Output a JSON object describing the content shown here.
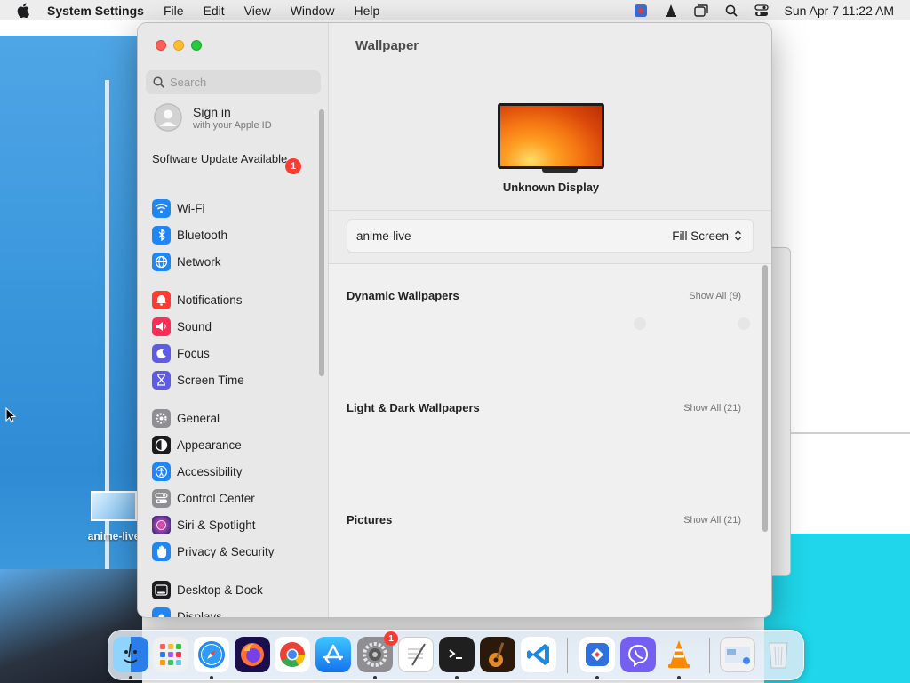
{
  "menubar": {
    "app_name": "System Settings",
    "items": [
      "File",
      "Edit",
      "View",
      "Window",
      "Help"
    ],
    "clock": "Sun Apr 7  11:22 AM"
  },
  "desktop": {
    "file_label": "anime-live"
  },
  "window": {
    "search_placeholder": "Search",
    "signin": {
      "title": "Sign in",
      "subtitle": "with your Apple ID"
    },
    "software_update": {
      "label": "Software Update Available",
      "badge": "1"
    },
    "sidebar_items": [
      {
        "label": "Wi-Fi",
        "icon": "wifi-icon",
        "color": "#1f87f5"
      },
      {
        "label": "Bluetooth",
        "icon": "bluetooth-icon",
        "color": "#1f87f5"
      },
      {
        "label": "Network",
        "icon": "globe-icon",
        "color": "#1f87f5"
      },
      {
        "label": "Notifications",
        "icon": "bell-icon",
        "color": "#ff3b30"
      },
      {
        "label": "Sound",
        "icon": "speaker-icon",
        "color": "#ff2d55"
      },
      {
        "label": "Focus",
        "icon": "moon-icon",
        "color": "#5e5ce6"
      },
      {
        "label": "Screen Time",
        "icon": "hourglass-icon",
        "color": "#5e5ce6"
      },
      {
        "label": "General",
        "icon": "gear-icon",
        "color": "#8e8e93"
      },
      {
        "label": "Appearance",
        "icon": "appearance-icon",
        "color": "#1c1c1e"
      },
      {
        "label": "Accessibility",
        "icon": "accessibility-icon",
        "color": "#1f87f5"
      },
      {
        "label": "Control Center",
        "icon": "control-center-icon",
        "color": "#8e8e93"
      },
      {
        "label": "Siri & Spotlight",
        "icon": "siri-icon",
        "color": "#6e3aa6"
      },
      {
        "label": "Privacy & Security",
        "icon": "hand-icon",
        "color": "#1f87f5"
      },
      {
        "label": "Desktop & Dock",
        "icon": "dock-icon",
        "color": "#1c1c1e"
      },
      {
        "label": "Displays",
        "icon": "display-icon",
        "color": "#1f87f5"
      }
    ],
    "main": {
      "title": "Wallpaper",
      "display_name": "Unknown Display",
      "wallpaper_name": "anime-live",
      "fill_mode": "Fill Screen",
      "sections": [
        {
          "title": "Dynamic Wallpapers",
          "show_all": "Show All (9)"
        },
        {
          "title": "Light & Dark Wallpapers",
          "show_all": "Show All (21)"
        },
        {
          "title": "Pictures",
          "show_all": "Show All (21)"
        }
      ]
    }
  },
  "dock": {
    "apps": [
      {
        "name": "Finder",
        "icon": "finder-icon",
        "running": true
      },
      {
        "name": "Launchpad",
        "icon": "launchpad-icon",
        "running": false
      },
      {
        "name": "Safari",
        "icon": "safari-icon",
        "running": true
      },
      {
        "name": "Firefox",
        "icon": "firefox-icon",
        "running": false
      },
      {
        "name": "Chrome",
        "icon": "chrome-icon",
        "running": false
      },
      {
        "name": "App Store",
        "icon": "app-store-icon",
        "running": false
      },
      {
        "name": "System Settings",
        "icon": "settings-icon",
        "running": true,
        "badge": "1"
      },
      {
        "name": "TextEdit",
        "icon": "textedit-icon",
        "running": false
      },
      {
        "name": "Terminal",
        "icon": "terminal-icon",
        "running": true
      },
      {
        "name": "GarageBand",
        "icon": "guitar-icon",
        "running": false
      },
      {
        "name": "VS Code",
        "icon": "vscode-icon",
        "running": false
      },
      {
        "name": "Remote Desktop",
        "icon": "remote-desktop-icon",
        "running": true
      },
      {
        "name": "Viber",
        "icon": "viber-icon",
        "running": false
      },
      {
        "name": "VLC",
        "icon": "vlc-icon",
        "running": true
      },
      {
        "name": "Downloads",
        "icon": "downloads-stack-icon",
        "running": false
      },
      {
        "name": "Trash",
        "icon": "trash-icon",
        "running": false
      }
    ]
  }
}
